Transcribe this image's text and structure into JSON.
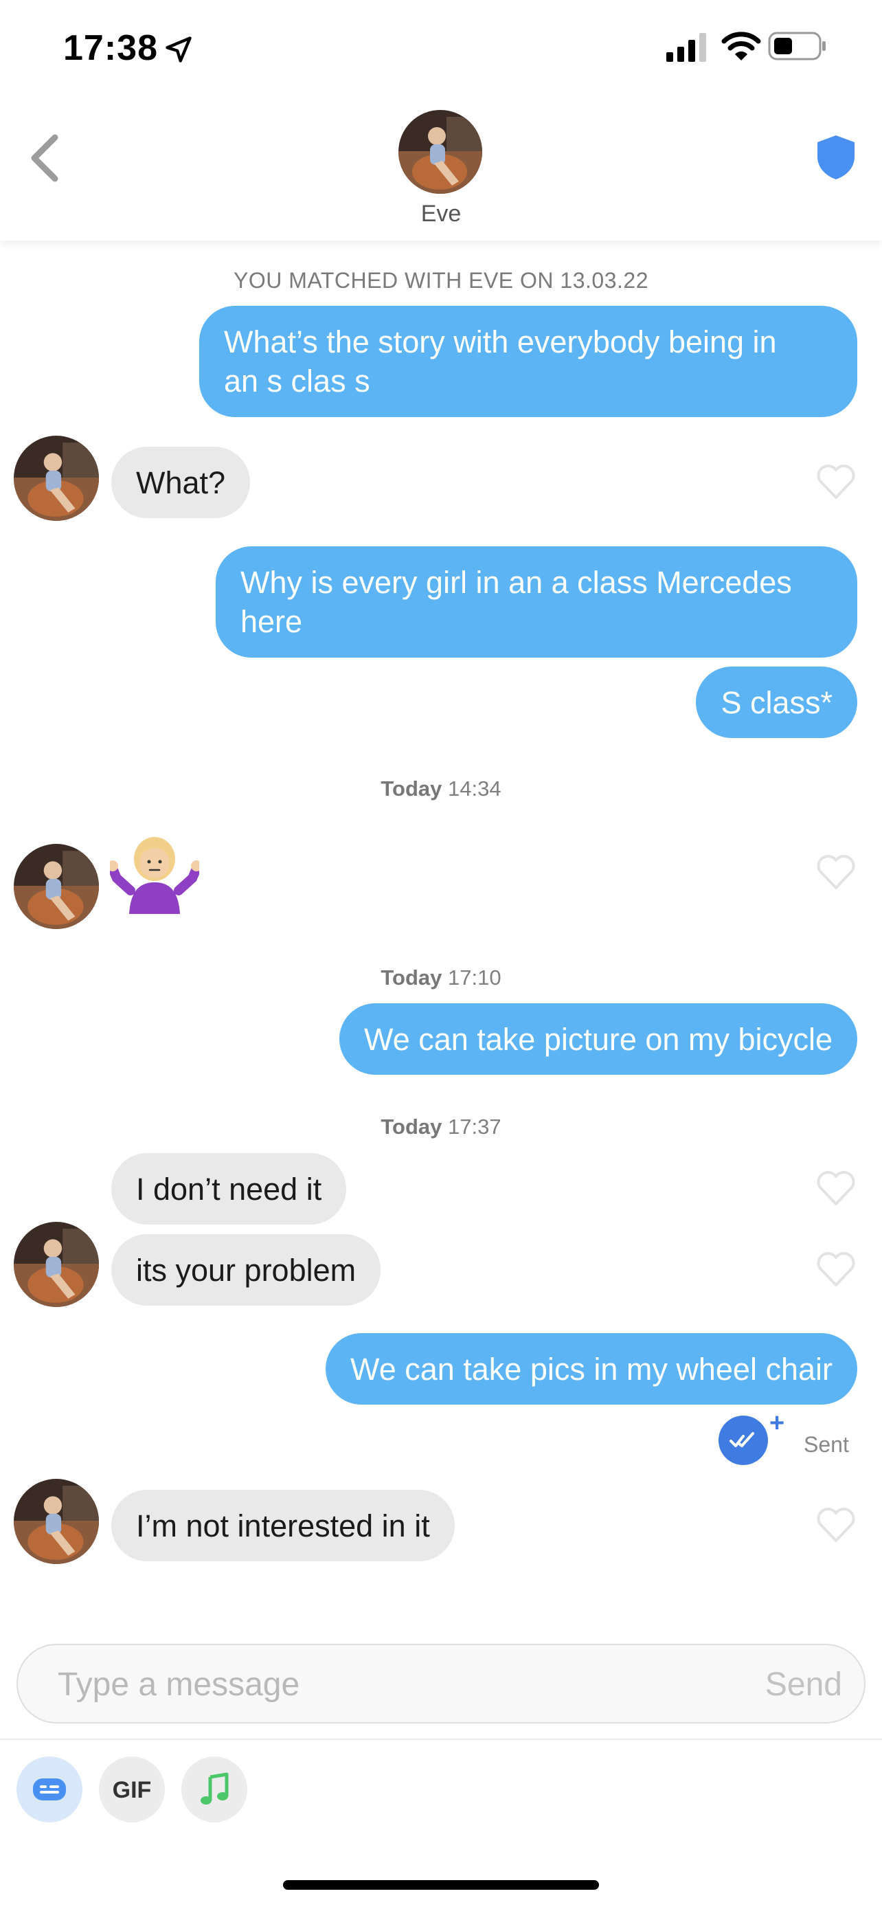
{
  "status_bar": {
    "time": "17:38"
  },
  "header": {
    "contact_name": "Eve"
  },
  "conversation": {
    "match_note": "YOU MATCHED WITH EVE ON 13.03.22",
    "messages": [
      {
        "dir": "out",
        "text_line1": "What’s the story with everybody being in",
        "text_line2": "an s clas s"
      },
      {
        "dir": "in",
        "text": "What?"
      },
      {
        "dir": "out",
        "text_line1": "Why is every girl in an a class Mercedes",
        "text_line2": "here"
      },
      {
        "dir": "out",
        "text": "S class*"
      },
      {
        "dir": "in",
        "text": "I don’t need it"
      },
      {
        "dir": "in",
        "text": "its your problem"
      },
      {
        "dir": "out",
        "text": "We can take picture on my bicycle"
      },
      {
        "dir": "out",
        "text": "We can take pics in my wheel chair"
      },
      {
        "dir": "in",
        "text": "I’m not interested in it"
      }
    ],
    "timestamps": [
      {
        "day": "Today",
        "time": "14:34"
      },
      {
        "day": "Today",
        "time": "17:10"
      },
      {
        "day": "Today",
        "time": "17:37"
      }
    ],
    "sent_status": "Sent",
    "sent_plus": "+"
  },
  "composer": {
    "placeholder": "Type a message",
    "send_label": "Send"
  },
  "toolbar": {
    "gif_label": "GIF"
  },
  "colors": {
    "outgoing_bubble": "#5db4f5",
    "incoming_bubble": "#e9e9e9",
    "accent_blue": "#3f7be0",
    "music_green": "#4cc76a"
  },
  "icons": [
    "location-arrow-icon",
    "signal-icon",
    "wifi-icon",
    "battery-icon",
    "back-chevron-icon",
    "shield-icon",
    "heart-icon",
    "sticker-icon",
    "music-note-icon",
    "double-check-icon"
  ]
}
